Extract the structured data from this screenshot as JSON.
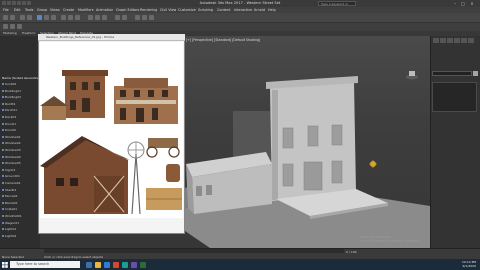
{
  "window": {
    "title": "Autodesk 3ds Max 2017 - Western Street Set"
  },
  "search": {
    "placeholder": "Type a keyword or phrase"
  },
  "menu": {
    "items": [
      "File",
      "Edit",
      "Tools",
      "Group",
      "Views",
      "Create",
      "Modifiers",
      "Animation",
      "Graph Editors",
      "Rendering",
      "Civil View",
      "Customize",
      "Scripting",
      "Content",
      "Interactive",
      "Arnold",
      "Help"
    ]
  },
  "ribbon_tabs": [
    "Modeling",
    "Freeform",
    "Selection",
    "Object Paint",
    "Populate"
  ],
  "scene_explorer": {
    "header": "Name (Sorted Ascending)",
    "rows": [
      "Sun001",
      "Building01",
      "Building02",
      "Roof01",
      "Porch01",
      "Deck01",
      "Door01",
      "Door02",
      "Window01",
      "Window02",
      "Window03",
      "Window04",
      "Window05",
      "Sign01",
      "Ground01",
      "Camera01",
      "Shed01",
      "Fence01",
      "Barrel01",
      "Crate01",
      "Windmill01",
      "Wagon01",
      "Light01",
      "Light02"
    ]
  },
  "viewport": {
    "label": "[+] [Perspective] [Standard] [Default Shading]"
  },
  "image_viewer": {
    "title": "Western_Buildings_Reference_01.jpg - Photos"
  },
  "command_panel": {
    "tabs": [
      "create",
      "modify",
      "hierarchy",
      "motion",
      "display",
      "utilities"
    ]
  },
  "status": {
    "selection": "None Selected",
    "prompt": "Click or click-and-drag to select objects",
    "frame": "0 / 100",
    "watermark_line1": "Activate Windows",
    "watermark_line2": "Go to Settings to activate Windows."
  },
  "taskbar": {
    "search_placeholder": "Type here to search",
    "time": "10:14 PM",
    "date": "9/1/2020"
  },
  "colors": {
    "ui_dark": "#2b2b2b",
    "taskbar": "#1c2b3a",
    "selection_blue": "#5c88c4"
  }
}
